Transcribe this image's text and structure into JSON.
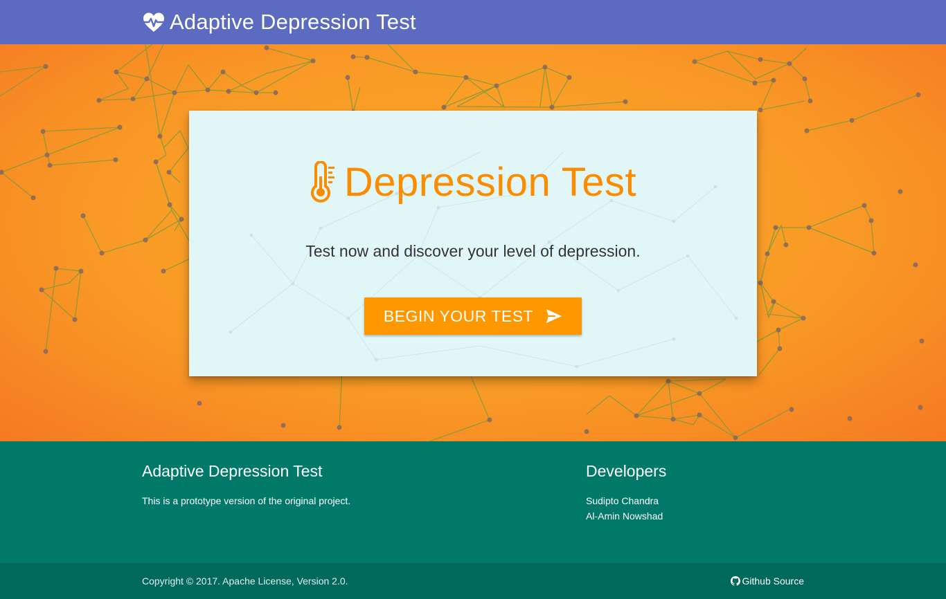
{
  "navbar": {
    "brand_icon": "heartbeat-icon",
    "brand_title": "Adaptive Depression Test",
    "background": "#5c6bc0"
  },
  "hero": {
    "background": "#f99a26",
    "card": {
      "title_icon": "thermometer-icon",
      "title": "Depression Test",
      "subtitle": "Test now and discover your level of depression.",
      "button_label": "BEGIN YOUR TEST",
      "button_icon": "send-icon",
      "accent": "#ff9800"
    }
  },
  "footer": {
    "about_title": "Adaptive Depression Test",
    "about_text": "This is a prototype version of the original project.",
    "developers_title": "Developers",
    "developers": [
      "Sudipto Chandra",
      "Al-Amin Nowshad"
    ],
    "background": "#00796b"
  },
  "footer_bottom": {
    "copyright": "Copyright © 2017. Apache License, Version 2.0.",
    "github_icon": "github-icon",
    "github_label": "Github Source"
  }
}
